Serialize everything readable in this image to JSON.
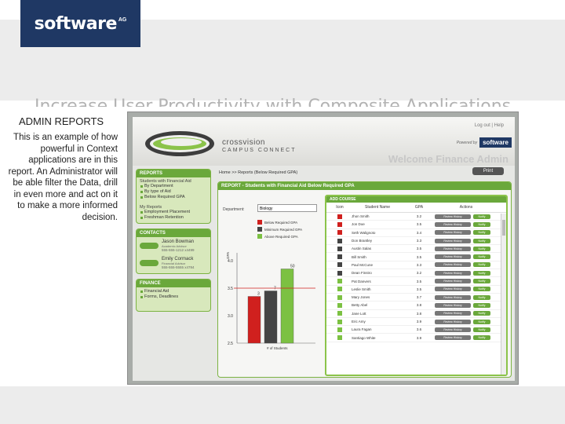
{
  "slide": {
    "logo": "software",
    "logo_ag": "AG",
    "title": "Increase User Productivity with Composite Applications"
  },
  "side": {
    "heading": "ADMIN REPORTS",
    "body": "This is an example of how powerful in Context applications are in this report. An Administrator will be able filter the Data, drill in even more and act on it to make a more informed decision."
  },
  "app": {
    "brand": "crossvision",
    "brand_sub": "CAMPUS CONNECT",
    "top_links": "Log out | Help",
    "powered_by": "Powered by",
    "powered_logo": "software",
    "welcome": "Welcome Finance Admin",
    "print": "Print",
    "breadcrumb": "Home >> Reports (Below Required GPA)",
    "nav": {
      "reports_head": "REPORTS",
      "students_aid": "Students with Financial Aid",
      "aid_items": [
        "By Department",
        "By type of Aid",
        "Below Required GPA"
      ],
      "my_reports": "My Reports",
      "my_items": [
        "Employment Placement",
        "Freshman Retention"
      ],
      "contacts_head": "CONTACTS",
      "contacts": [
        {
          "name": "Jason Bowman",
          "role": "Academic Advisor",
          "phone": "555-555-1212 x4499"
        },
        {
          "name": "Emily Cormack",
          "role": "Financial Advisor",
          "phone": "555-555-5555 x4784"
        }
      ],
      "finance_head": "FINANCE",
      "finance_items": [
        "Financial Aid",
        "Forms, Deadlines"
      ]
    },
    "report": {
      "title": "REPORT - Students with Financial Aid Below Required GPA",
      "department_label": "Department:",
      "department_value": "Biology",
      "legend": [
        {
          "label": "Below Required GPA",
          "color": "#d0201e"
        },
        {
          "label": "Minimum Required GPA",
          "color": "#444444"
        },
        {
          "label": "Above Required GPA",
          "color": "#7cc142"
        }
      ],
      "add_course": "ADD COURSE",
      "columns": [
        "Icon",
        "Student Name",
        "GPA",
        "Actions"
      ],
      "review_label": "Review History",
      "notify_label": "Notify",
      "students": [
        {
          "name": "Jhon Smith",
          "gpa": "3.2",
          "status": "red"
        },
        {
          "name": "Jon Doe",
          "gpa": "3.5",
          "status": "red"
        },
        {
          "name": "Seth Walignoto",
          "gpa": "3.4",
          "status": "red"
        },
        {
          "name": "Don Brantley",
          "gpa": "3.3",
          "status": "dark"
        },
        {
          "name": "Austin Salas",
          "gpa": "3.5",
          "status": "dark"
        },
        {
          "name": "Bill Smith",
          "gpa": "3.5",
          "status": "dark"
        },
        {
          "name": "Paul McCune",
          "gpa": "3.3",
          "status": "dark"
        },
        {
          "name": "Dean Finstro",
          "gpa": "3.2",
          "status": "dark"
        },
        {
          "name": "Pat Danvers",
          "gpa": "3.5",
          "status": "green"
        },
        {
          "name": "Leslie Smith",
          "gpa": "3.5",
          "status": "green"
        },
        {
          "name": "Mary Jones",
          "gpa": "3.7",
          "status": "green"
        },
        {
          "name": "Betty Abel",
          "gpa": "3.8",
          "status": "green"
        },
        {
          "name": "Jane Lott",
          "gpa": "3.8",
          "status": "green"
        },
        {
          "name": "Eric Amy",
          "gpa": "3.9",
          "status": "green"
        },
        {
          "name": "Laura Fagan",
          "gpa": "3.6",
          "status": "green"
        },
        {
          "name": "Santiago White",
          "gpa": "3.9",
          "status": "green"
        }
      ]
    }
  },
  "chart_data": {
    "type": "bar",
    "ylabel": "GPA",
    "xlabel": "# of Students",
    "ylim": [
      2.5,
      4.0
    ],
    "ticks": [
      "2.5",
      "3.0",
      "3.5",
      "4.0"
    ],
    "reference_value": 3.5,
    "bars": [
      {
        "value": 3.35,
        "label": "3",
        "color": "#d0201e"
      },
      {
        "value": 3.45,
        "label": "7",
        "color": "#444444"
      },
      {
        "value": 3.85,
        "label": "50",
        "color": "#7cc142"
      }
    ]
  }
}
